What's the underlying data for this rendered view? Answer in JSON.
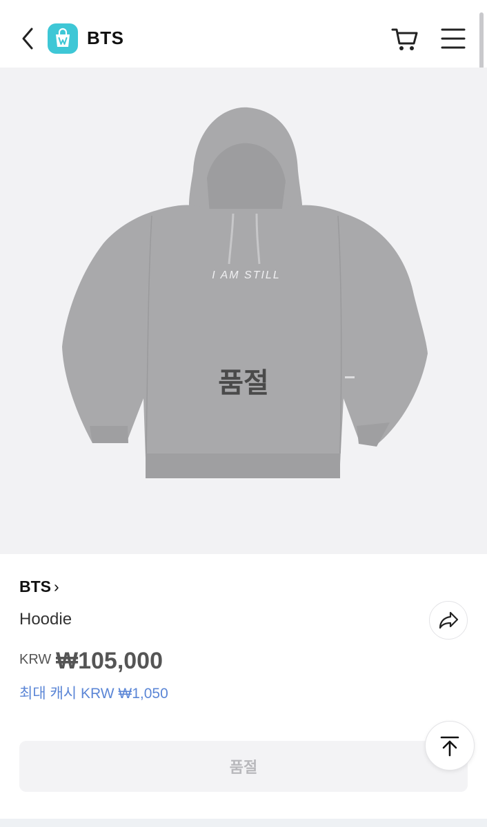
{
  "header": {
    "title": "BTS",
    "icons": {
      "back": "chevron-left-icon",
      "app": "weverse-shop-icon",
      "cart": "cart-icon",
      "menu": "hamburger-menu-icon"
    },
    "app_icon_color": "#3ec7d6"
  },
  "product_image": {
    "print_text": "I AM STILL",
    "sold_out_overlay": "품절"
  },
  "product": {
    "brand": "BTS",
    "brand_chevron": "›",
    "name": "Hoodie",
    "currency": "KRW",
    "price": "₩105,000",
    "cash_reward": "최대 캐시 KRW ₩1,050",
    "share_icon": "share-icon"
  },
  "actions": {
    "buy_label": "품절",
    "scroll_top_icon": "arrow-up-to-top-icon"
  },
  "colors": {
    "accent_cash": "#5b86d6",
    "price_text": "#555555",
    "disabled_button_text": "#b8b8bc"
  }
}
